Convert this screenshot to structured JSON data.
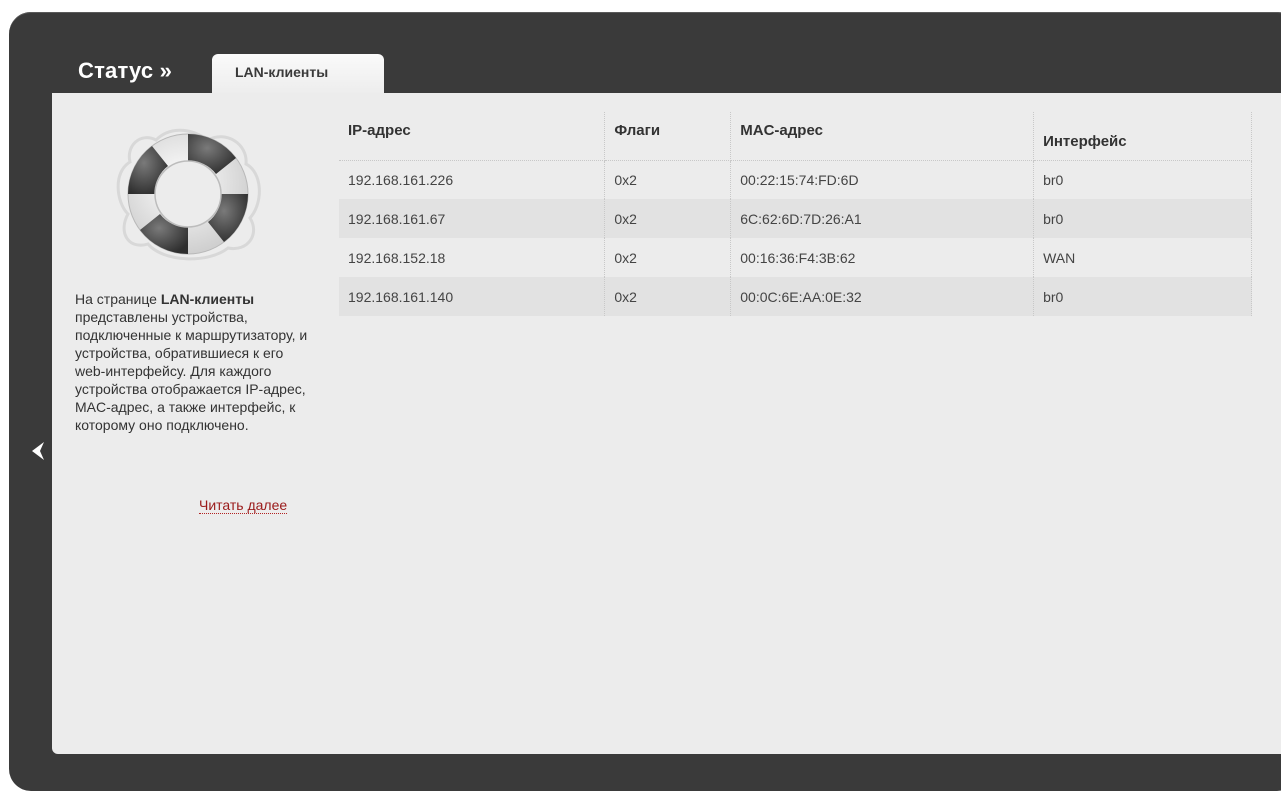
{
  "header": {
    "title": "Статус »",
    "tab_label": "LAN-клиенты"
  },
  "sidebar": {
    "help_prefix": "На странице ",
    "help_bold": "LAN-клиенты",
    "help_rest": " представлены устройства, подключенные к маршрутизатору, и устройства, обратившиеся к его web-интерфейсу. Для каждого устройства отображается IP-адрес, MAC-адрес, а также интерфейс, к которому оно подключено.",
    "read_more": "Читать далее",
    "icon": "lifebuoy-icon"
  },
  "table": {
    "headers": {
      "ip": "IP-адрес",
      "flags": "Флаги",
      "mac": "MAC-адрес",
      "iface": "Интерфейс"
    },
    "rows": [
      {
        "ip": "192.168.161.226",
        "flags": "0x2",
        "mac": "00:22:15:74:FD:6D",
        "iface": "br0"
      },
      {
        "ip": "192.168.161.67",
        "flags": "0x2",
        "mac": "6C:62:6D:7D:26:A1",
        "iface": "br0"
      },
      {
        "ip": "192.168.152.18",
        "flags": "0x2",
        "mac": "00:16:36:F4:3B:62",
        "iface": "WAN"
      },
      {
        "ip": "192.168.161.140",
        "flags": "0x2",
        "mac": "00:0C:6E:AA:0E:32",
        "iface": "br0"
      }
    ]
  },
  "nav": {
    "back_icon": "chevron-left-icon"
  },
  "colors": {
    "frame": "#3a3a3a",
    "panel": "#ececec",
    "link": "#9a1a1a"
  }
}
